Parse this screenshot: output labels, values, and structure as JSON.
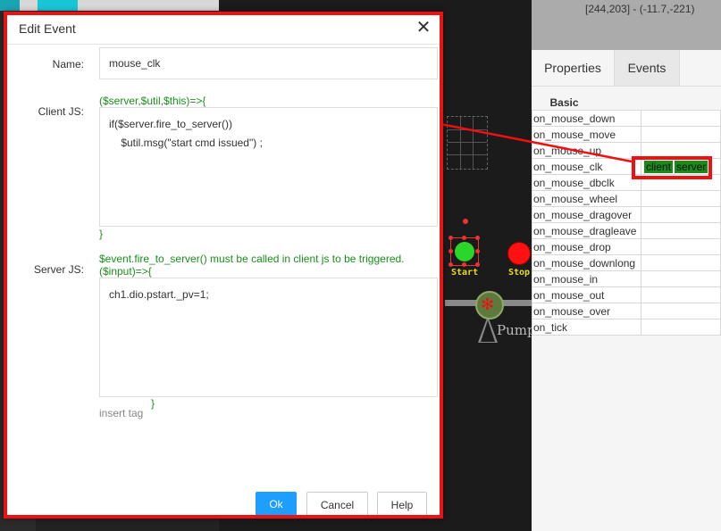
{
  "background": {
    "start_label": "Start",
    "stop_label": "Stop",
    "pump_label": "Pump"
  },
  "right_panel": {
    "coordinates": "[244,203] - (-11.7,-221)",
    "tabs": [
      "Properties",
      "Events"
    ],
    "active_tab": "Events",
    "section_header": "Basic",
    "events": [
      {
        "name": "on_mouse_down",
        "value": ""
      },
      {
        "name": "on_mouse_move",
        "value": ""
      },
      {
        "name": "on_mouse_up",
        "value": ""
      },
      {
        "name": "on_mouse_clk",
        "value": "",
        "tags": [
          "client",
          "server"
        ]
      },
      {
        "name": "on_mouse_dbclk",
        "value": ""
      },
      {
        "name": "on_mouse_wheel",
        "value": ""
      },
      {
        "name": "on_mouse_dragover",
        "value": ""
      },
      {
        "name": "on_mouse_dragleave",
        "value": ""
      },
      {
        "name": "on_mouse_drop",
        "value": ""
      },
      {
        "name": "on_mouse_downlong",
        "value": ""
      },
      {
        "name": "on_mouse_in",
        "value": ""
      },
      {
        "name": "on_mouse_out",
        "value": ""
      },
      {
        "name": "on_mouse_over",
        "value": ""
      },
      {
        "name": "on_tick",
        "value": ""
      }
    ]
  },
  "dialog": {
    "title": "Edit Event",
    "name_label": "Name:",
    "name_value": "mouse_clk",
    "client_label": "Client JS:",
    "client_header": "($server,$util,$this)=>{",
    "client_code": "if($server.fire_to_server())\n    $util.msg(\"start cmd issued\") ;",
    "client_footer": "}",
    "server_label": "Server JS:",
    "server_note": "$event.fire_to_server() must be called in client js to be triggered.",
    "server_header": "($input)=>{",
    "server_code": "ch1.dio.pstart._pv=1;",
    "server_footer": "}",
    "insert_tag": "insert tag",
    "buttons": {
      "ok": "Ok",
      "cancel": "Cancel",
      "help": "Help"
    }
  },
  "colors": {
    "highlight": "#ee1111",
    "primary_button": "#1e9fff",
    "code_hint": "#1a8f1a",
    "event_tag": "#1a8a1a"
  }
}
